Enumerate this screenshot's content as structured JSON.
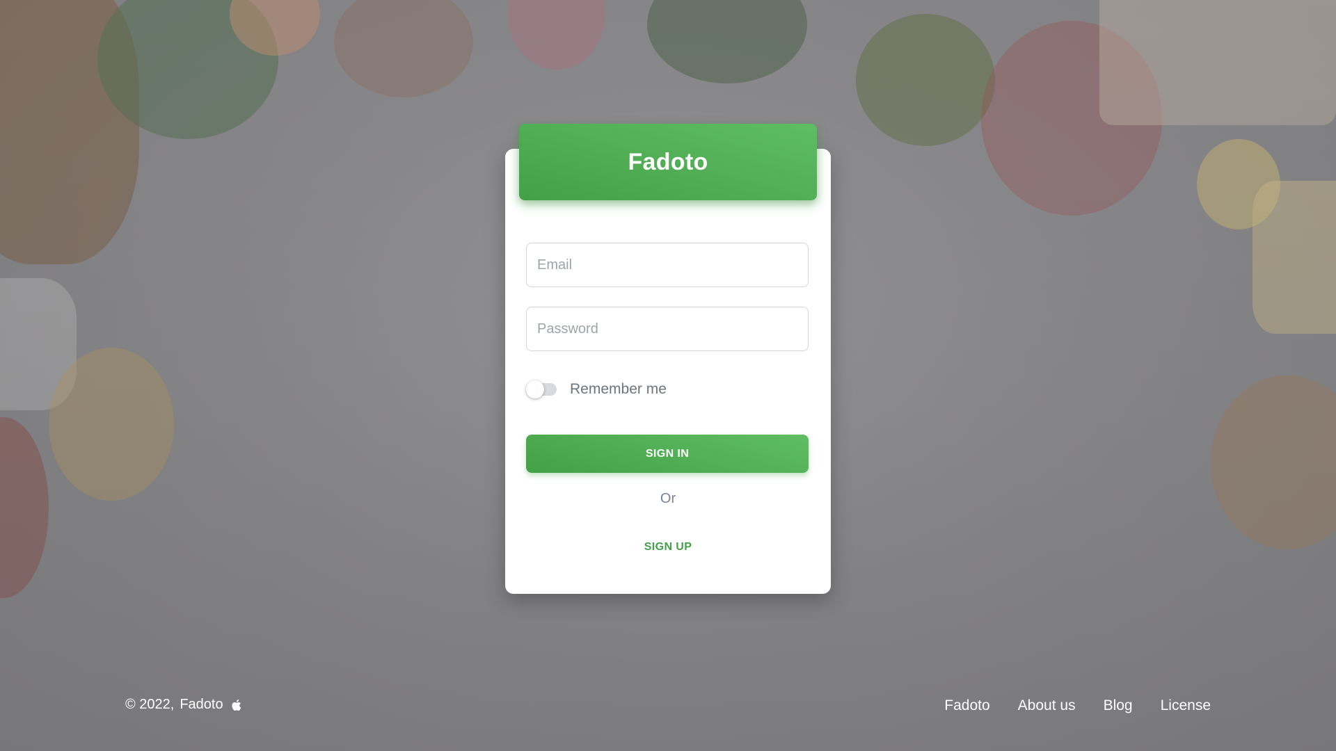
{
  "brand": {
    "title": "Fadoto"
  },
  "form": {
    "email_placeholder": "Email",
    "password_placeholder": "Password",
    "remember_label": "Remember me",
    "remember_checked": false,
    "signin_label": "SIGN IN",
    "or_text": "Or",
    "signup_label": "SIGN UP"
  },
  "footer": {
    "copyright": "© 2022,",
    "brand": "Fadoto",
    "icon": "apple-icon",
    "links": [
      {
        "label": "Fadoto"
      },
      {
        "label": "About us"
      },
      {
        "label": "Blog"
      },
      {
        "label": "License"
      }
    ]
  },
  "colors": {
    "accent": "#4caf50",
    "accent_dark": "#43a047",
    "card_bg": "#ffffff",
    "page_bg": "#86868a"
  }
}
